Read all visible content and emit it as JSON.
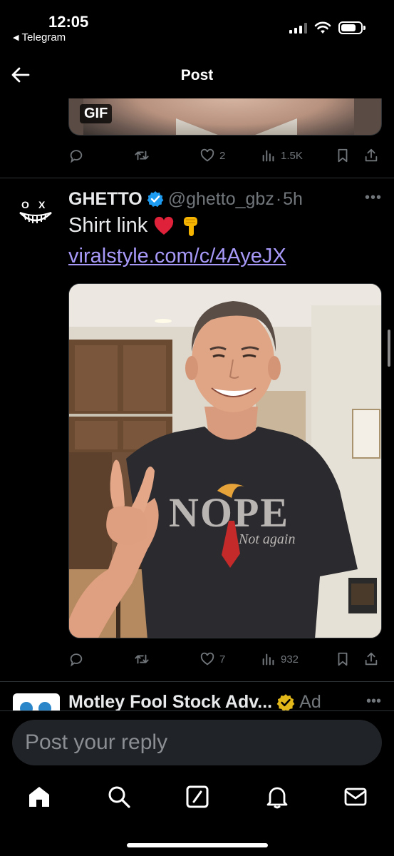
{
  "status_bar": {
    "time": "12:05",
    "back_app": "Telegram",
    "battery_percent": 75
  },
  "header": {
    "title": "Post"
  },
  "previous_post": {
    "media_badge": "GIF",
    "actions": {
      "replies": "",
      "reposts": "",
      "likes": "2",
      "views": "1.5K"
    }
  },
  "post": {
    "author_name": "GHETTO",
    "handle": "@ghetto_gbz",
    "separator": "·",
    "time_ago": "5h",
    "text": "Shirt link",
    "emojis": [
      "red-heart-icon",
      "pointing-down-icon"
    ],
    "link": "viralstyle.com/c/4AyeJX",
    "shirt_text_main": "NOPE",
    "shirt_text_sub": "Not again",
    "actions": {
      "replies": "",
      "reposts": "",
      "likes": "7",
      "views": "932"
    }
  },
  "ad": {
    "name": "Motley Fool Stock Adv...",
    "label": "Ad"
  },
  "composer": {
    "placeholder": "Post your reply"
  },
  "bottom_nav": [
    "home-icon",
    "search-icon",
    "grok-icon",
    "notifications-icon",
    "messages-icon"
  ],
  "colors": {
    "background": "#000000",
    "link": "#a799f7",
    "verified_blue": "#1d9bf0",
    "verified_gold": "#e2b719",
    "muted": "#71767b"
  }
}
